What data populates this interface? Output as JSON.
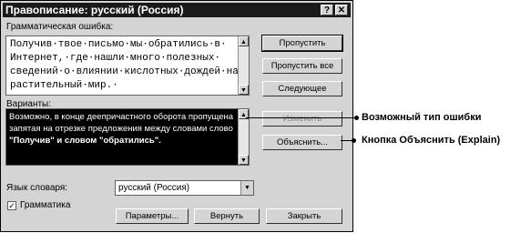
{
  "window": {
    "title": "Правописание: русский (Россия)",
    "help_btn": "?",
    "close_btn": "✕"
  },
  "error_section": {
    "label": "Грамматическая ошибка:",
    "lines": [
      "Получив·твое·письмо·мы·обратились·в·",
      "Интернет,·где·нашли·много·полезных·",
      "сведений·о·влиянии·кислотных·дождей·на·",
      "растительный·мир.·"
    ]
  },
  "suggestions": {
    "label": "Варианты:",
    "lines": [
      "Возможно, в конце деепричастного оборота пропущена",
      "запятая на отрезке предложения между словами слово",
      "\"Получив\" и словом \"обратились\"."
    ]
  },
  "buttons": {
    "skip": "Пропустить",
    "skip_all": "Пропустить все",
    "next": "Следующее",
    "change": "Изменить",
    "explain": "Объяснить...",
    "options": "Параметры...",
    "undo": "Вернуть",
    "close": "Закрыть"
  },
  "dictionary": {
    "label": "Язык словаря:",
    "value": "русский (Россия)"
  },
  "grammar_check": {
    "label": "Грамматика",
    "checked": true
  },
  "callouts": {
    "error_type": "Возможный тип ошибки",
    "explain": "Кнопка Объяснить (Explain)"
  }
}
